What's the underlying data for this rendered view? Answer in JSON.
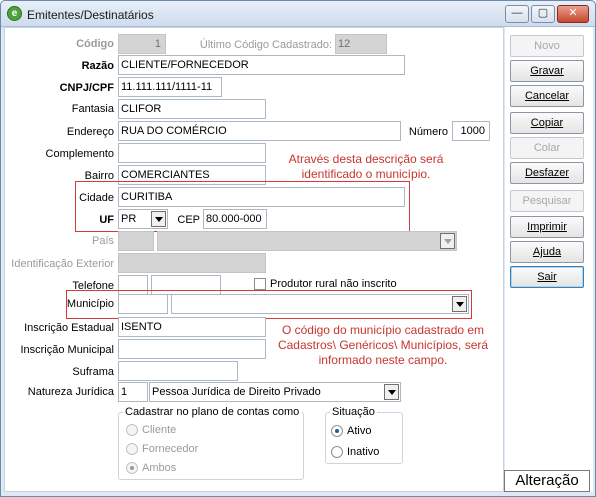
{
  "window": {
    "title": "Emitentes/Destinatários",
    "app_icon": "app-logo-icon",
    "min": "—",
    "max": "▢",
    "close": "✕"
  },
  "form": {
    "codigo": {
      "label": "Código",
      "value": "1"
    },
    "ultimo_codigo": {
      "label": "Último Código Cadastrado:",
      "value": "12"
    },
    "razao": {
      "label": "Razão",
      "value": "CLIENTE/FORNECEDOR"
    },
    "cnpj": {
      "label": "CNPJ/CPF",
      "value": "11.111.111/1111-11"
    },
    "fantasia": {
      "label": "Fantasia",
      "value": "CLIFOR"
    },
    "endereco": {
      "label": "Endereço",
      "value": "RUA DO COMÉRCIO"
    },
    "numero": {
      "label": "Número",
      "value": "1000"
    },
    "complemento": {
      "label": "Complemento",
      "value": ""
    },
    "bairro": {
      "label": "Bairro",
      "value": "COMERCIANTES"
    },
    "cidade": {
      "label": "Cidade",
      "value": "CURITIBA"
    },
    "uf": {
      "label": "UF",
      "value": "PR"
    },
    "cep": {
      "label": "CEP",
      "value": "80.000-000"
    },
    "pais": {
      "label": "País",
      "code": "",
      "value": ""
    },
    "id_exterior": {
      "label": "Identificação Exterior",
      "value": ""
    },
    "telefone": {
      "label": "Telefone",
      "ddd": "",
      "value": ""
    },
    "produtor_rural": {
      "label": "Produtor rural não inscrito",
      "checked": false
    },
    "municipio": {
      "label": "Município",
      "code": "",
      "value": ""
    },
    "inscricao_estadual": {
      "label": "Inscrição Estadual",
      "value": "ISENTO"
    },
    "inscricao_municipal": {
      "label": "Inscrição Municipal",
      "value": ""
    },
    "suframa": {
      "label": "Suframa",
      "value": ""
    },
    "natureza": {
      "label": "Natureza Jurídica",
      "code": "1",
      "value": "Pessoa Jurídica de Direito Privado"
    }
  },
  "notes": {
    "cidade_line1": "Através desta descrição será",
    "cidade_line2": "identificado o município.",
    "municipio_line1": "O código do município cadastrado em",
    "municipio_line2": "Cadastros\\ Genéricos\\ Municípios, será",
    "municipio_line3": "informado neste campo.",
    "color": "#c8352f"
  },
  "plano_contas": {
    "title": "Cadastrar no plano de contas como",
    "options": [
      "Cliente",
      "Fornecedor",
      "Ambos"
    ],
    "selected": "Ambos"
  },
  "situacao": {
    "title": "Situação",
    "options": [
      "Ativo",
      "Inativo"
    ],
    "selected": "Ativo"
  },
  "actions": {
    "novo": "Novo",
    "gravar": "Gravar",
    "cancelar": "Cancelar",
    "copiar": "Copiar",
    "colar": "Colar",
    "desfazer": "Desfazer",
    "pesquisar": "Pesquisar",
    "imprimir": "Imprimir",
    "ajuda": "Ajuda",
    "sair": "Sair"
  },
  "status": "Alteração"
}
